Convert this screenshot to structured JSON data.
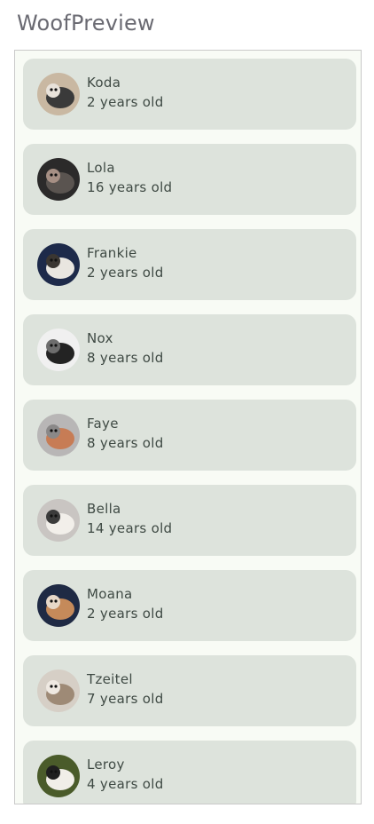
{
  "app": {
    "title": "WoofPreview"
  },
  "dogs": [
    {
      "name": "Koda",
      "age": "2 years old",
      "avatar_icon": "husky-photo-icon",
      "colors": [
        "#c9b8a2",
        "#3a3a3a",
        "#e8e2da"
      ]
    },
    {
      "name": "Lola",
      "age": "16 years old",
      "avatar_icon": "black-dog-photo-icon",
      "colors": [
        "#2b2a2a",
        "#5a5450",
        "#a68f84"
      ]
    },
    {
      "name": "Frankie",
      "age": "2 years old",
      "avatar_icon": "small-dog-photo-icon",
      "colors": [
        "#1d2a4a",
        "#e9e6e0",
        "#3a3632"
      ]
    },
    {
      "name": "Nox",
      "age": "8 years old",
      "avatar_icon": "black-white-dog-photo-icon",
      "colors": [
        "#f0f0f0",
        "#232323",
        "#6d6d6d"
      ]
    },
    {
      "name": "Faye",
      "age": "8 years old",
      "avatar_icon": "dog-on-floor-photo-icon",
      "colors": [
        "#b8b6b6",
        "#c77c55",
        "#8a8888"
      ]
    },
    {
      "name": "Bella",
      "age": "14 years old",
      "avatar_icon": "white-dog-photo-icon",
      "colors": [
        "#c9c5c2",
        "#f2efea",
        "#3b3b3b"
      ]
    },
    {
      "name": "Moana",
      "age": "2 years old",
      "avatar_icon": "corgi-photo-icon",
      "colors": [
        "#1f2a44",
        "#c58a5a",
        "#e7d8c8"
      ]
    },
    {
      "name": "Tzeitel",
      "age": "7 years old",
      "avatar_icon": "sleeping-dog-photo-icon",
      "colors": [
        "#d6cfc6",
        "#9e8a76",
        "#efe9e2"
      ]
    },
    {
      "name": "Leroy",
      "age": "4 years old",
      "avatar_icon": "corgi-grass-photo-icon",
      "colors": [
        "#4a5b2a",
        "#f1eee8",
        "#1f1f1f"
      ]
    }
  ]
}
